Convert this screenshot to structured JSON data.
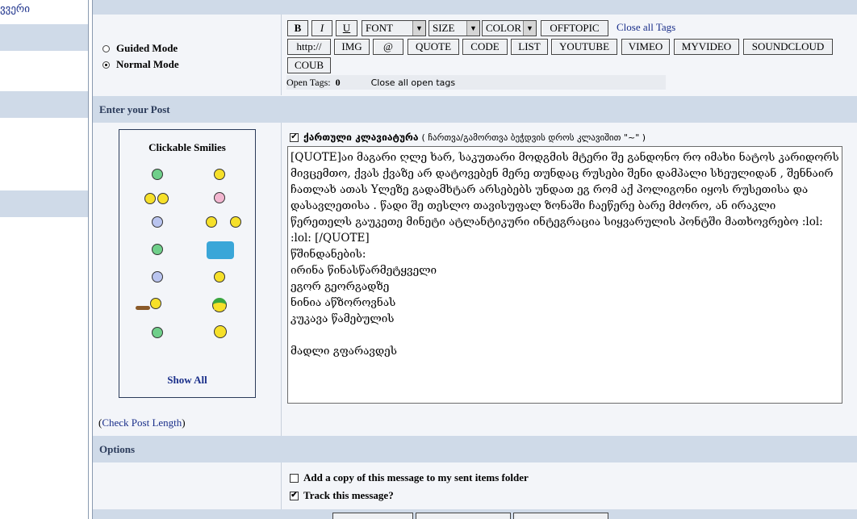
{
  "sidebar": {
    "link_text": "ვვერი"
  },
  "modes": {
    "guided": "Guided Mode",
    "normal": "Normal Mode",
    "selected": "normal"
  },
  "toolbar": {
    "bold": "B",
    "italic": "I",
    "underline": "U",
    "font": "FONT",
    "size": "SIZE",
    "color": "COLOR",
    "offtopic": "OFFTOPIC",
    "close_all_tags": "Close all Tags",
    "http": "http://",
    "img": "IMG",
    "at": "@",
    "quote": "QUOTE",
    "code": "CODE",
    "list": "LIST",
    "youtube": "YOUTUBE",
    "vimeo": "VIMEO",
    "myvideo": "MYVIDEO",
    "soundcloud": "SOUNDCLOUD",
    "coub": "COUB",
    "open_tags_label": "Open Tags:",
    "open_tags_count": "0",
    "close_all_open_tags": "Close all open tags"
  },
  "sections": {
    "enter_post": "Enter your Post",
    "options": "Options"
  },
  "smilies": {
    "title": "Clickable Smilies",
    "show_all": "Show All"
  },
  "keyboard": {
    "label": "ქართული კლავიატურა",
    "hint": "( ჩართვა/გამორთვა ბეჭდვის დროს კლავიშით \"~\" )",
    "checked": true
  },
  "post": {
    "text": "[QUOTE]აი მაგარი ღლე ხარ, საკუთარი მოდგმის მტერი შე განდონო რო იმახი ნატოს კარიდორს მივცემთო, ქვას ქვაზე არ დატოვებენ მერე თუნდაც რუსები შენი დამპალი სხეულიდან , შენნაირ ჩათლახ ათას Yლეზე გადამხტარ არსებებს უნდათ ეგ რომ აქ პოლიგონი იყოს რუსეთისა და დასავლეთისა . წადი შე თესლო თავისუფალ ზონაში ჩაეწერე ბარე მძორო, ან ირაკლი წერეთელს გაუკეთე მინეტი ატლანტიკური ინტეგრაცია სიყვარულის პონტში მათხოვრებო :lol: :lol: [/QUOTE]\nწშინდანების:\nირინა წინასწარმეტყველი\nეგორ გეორგადზე\nნინია აწზოროვნას\nკუკავა წამებულის\n\nმადლი გფარავდეს"
  },
  "check_length": {
    "open": "(",
    "link": "Check Post Length",
    "close": ")"
  },
  "options": {
    "copy_sent": {
      "label": "Add a copy of this message to my sent items folder",
      "checked": false
    },
    "track": {
      "label": "Track this message?",
      "checked": true
    }
  }
}
